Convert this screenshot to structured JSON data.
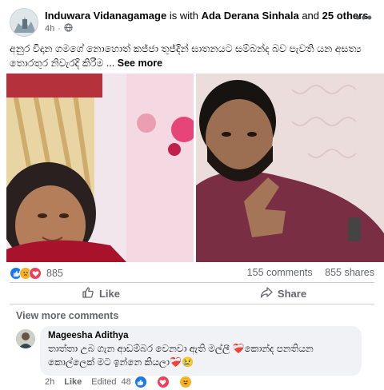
{
  "post": {
    "author": "Induwara Vidanagamage",
    "with_text": "is with",
    "tagged": "Ada Derana Sinhala",
    "and_text": "and",
    "others": "25 others.",
    "time": "4h",
    "caption": "අනුර විදාන ගමගේ නොහොත් කජ්ජා තුජ්දින් ඝාතනයට සම්බන්ද බව පැවති යන  අසත්‍ය තොරතුර නිවැරදි කිරීම ...",
    "see_more": "See more"
  },
  "stats": {
    "reaction_count": "885",
    "comments": "155 comments",
    "shares": "855 shares",
    "reaction_types": [
      "like",
      "sad",
      "love"
    ]
  },
  "actions": {
    "like": "Like",
    "share": "Share"
  },
  "comments": {
    "view_more": "View more comments",
    "items": [
      {
        "name": "Mageesha Adithya",
        "text": "තාත්තා උබ ගැන ආඩම්බර වෙනවා ඇති මල්ලී ❤️‍🩹කොන්ද පනතියන කොල්ලෙක් මට ඉන්නෙ කියලා❤️‍🩹😢",
        "time": "2h",
        "like": "Like",
        "edited": "Edited",
        "reaction_count": "48"
      }
    ]
  },
  "colors": {
    "muted": "#65676b",
    "like_blue": "#1877f2",
    "love_red": "#f33e58",
    "bubble": "#f0f2f5"
  }
}
